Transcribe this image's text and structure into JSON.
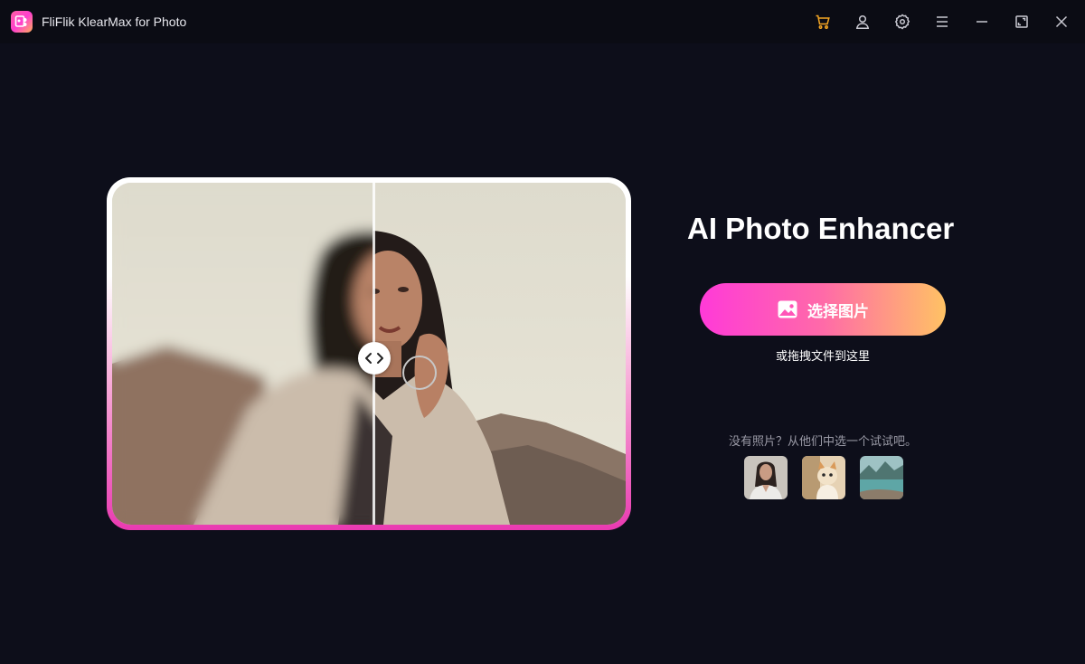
{
  "window": {
    "title": "FliFlik KlearMax for Photo",
    "logo_icon": "flower-photo-logo-icon",
    "controls": [
      {
        "name": "cart-icon",
        "color": "#f5a623"
      },
      {
        "name": "user-icon"
      },
      {
        "name": "gear-icon"
      },
      {
        "name": "menu-icon"
      },
      {
        "name": "minimize-icon"
      },
      {
        "name": "maximize-icon"
      },
      {
        "name": "close-icon"
      }
    ]
  },
  "compare": {
    "divider_position": 0.5,
    "handle_icon": "chevron-left-right-icon"
  },
  "main": {
    "title": "AI Photo Enhancer",
    "select_button": {
      "label": "选择图片",
      "icon": "image-icon",
      "gradient": [
        "#ff3ad8",
        "#ffc264"
      ]
    },
    "drag_hint": "或拖拽文件到这里",
    "sample_hint": "没有照片？从他们中选一个试试吧。",
    "samples": [
      "portrait-sample",
      "cat-sample",
      "lake-sample"
    ]
  },
  "colors": {
    "background": "#0d0e1a",
    "titlebar": "#0b0c14",
    "frame_gradient_bottom": "#e93ab1"
  }
}
